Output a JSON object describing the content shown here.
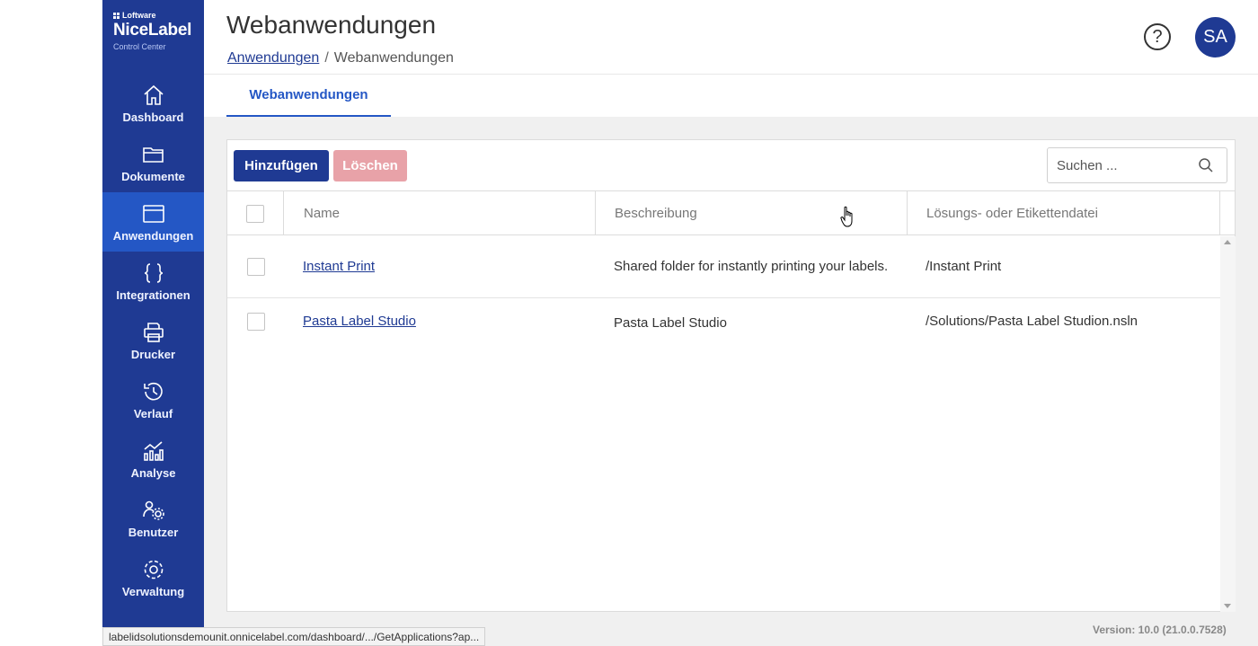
{
  "brand": {
    "company": "Loftware",
    "product": "NiceLabel",
    "subtitle": "Control Center"
  },
  "sidebar": {
    "items": [
      {
        "label": "Dashboard",
        "icon": "home-icon",
        "active": false
      },
      {
        "label": "Dokumente",
        "icon": "folder-icon",
        "active": false
      },
      {
        "label": "Anwendungen",
        "icon": "window-icon",
        "active": true
      },
      {
        "label": "Integrationen",
        "icon": "braces-icon",
        "active": false
      },
      {
        "label": "Drucker",
        "icon": "printer-icon",
        "active": false
      },
      {
        "label": "Verlauf",
        "icon": "history-icon",
        "active": false
      },
      {
        "label": "Analyse",
        "icon": "analytics-icon",
        "active": false
      },
      {
        "label": "Benutzer",
        "icon": "users-gear-icon",
        "active": false
      },
      {
        "label": "Verwaltung",
        "icon": "gear-icon",
        "active": false
      }
    ]
  },
  "header": {
    "title": "Webanwendungen",
    "breadcrumb": {
      "parent": "Anwendungen",
      "separator": "/",
      "current": "Webanwendungen"
    },
    "help": "?",
    "avatar": "SA"
  },
  "tabs": [
    {
      "label": "Webanwendungen",
      "active": true
    }
  ],
  "toolbar": {
    "add_label": "Hinzufügen",
    "delete_label": "Löschen",
    "search_placeholder": "Suchen ..."
  },
  "table": {
    "columns": [
      "Name",
      "Beschreibung",
      "Lösungs- oder Etikettendatei"
    ],
    "rows": [
      {
        "name": "Instant Print",
        "description": "Shared folder for instantly printing your labels.",
        "file": "/Instant Print"
      },
      {
        "name": "Pasta Label Studio",
        "description": "Pasta Label Studio",
        "file": "/Solutions/Pasta Label Studion.nsln"
      }
    ]
  },
  "footer": {
    "version": "Version: 10.0 (21.0.0.7528)"
  },
  "statusbar": {
    "url": "labelidsolutionsdemounit.onnicelabel.com/dashboard/.../GetApplications?ap..."
  },
  "colors": {
    "sidebar": "#1f3a93",
    "sidebar_active": "#2457c5",
    "accent": "#2457c5",
    "delete_disabled": "#e8a2a8"
  }
}
